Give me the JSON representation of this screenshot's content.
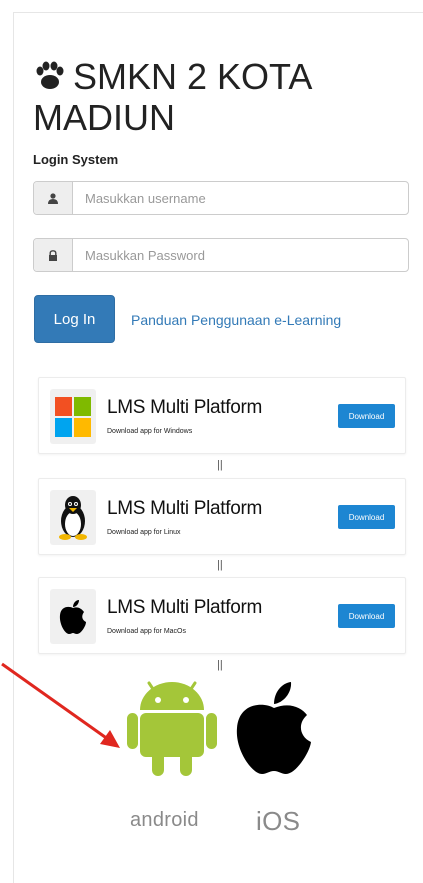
{
  "header": {
    "title": "SMKN 2 KOTA MADIUN",
    "subtitle": "Login System"
  },
  "form": {
    "username_placeholder": "Masukkan username",
    "password_placeholder": "Masukkan Password",
    "login_label": "Log In",
    "guide_link": "Panduan Penggunaan e-Learning"
  },
  "downloads": [
    {
      "title": "LMS Multi Platform",
      "subtitle": "Download app for Windows",
      "button": "Download",
      "icon": "windows-icon"
    },
    {
      "title": "LMS Multi Platform",
      "subtitle": "Download app for Linux",
      "button": "Download",
      "icon": "linux-icon"
    },
    {
      "title": "LMS Multi Platform",
      "subtitle": "Download app for MacOs",
      "button": "Download",
      "icon": "apple-icon"
    }
  ],
  "separator": "||",
  "mobile": {
    "android_label": "android",
    "ios_label": "iOS"
  },
  "colors": {
    "primary": "#337ab7",
    "download": "#1d86d2",
    "android_green": "#a4c639",
    "arrow_red": "#e0271f"
  }
}
